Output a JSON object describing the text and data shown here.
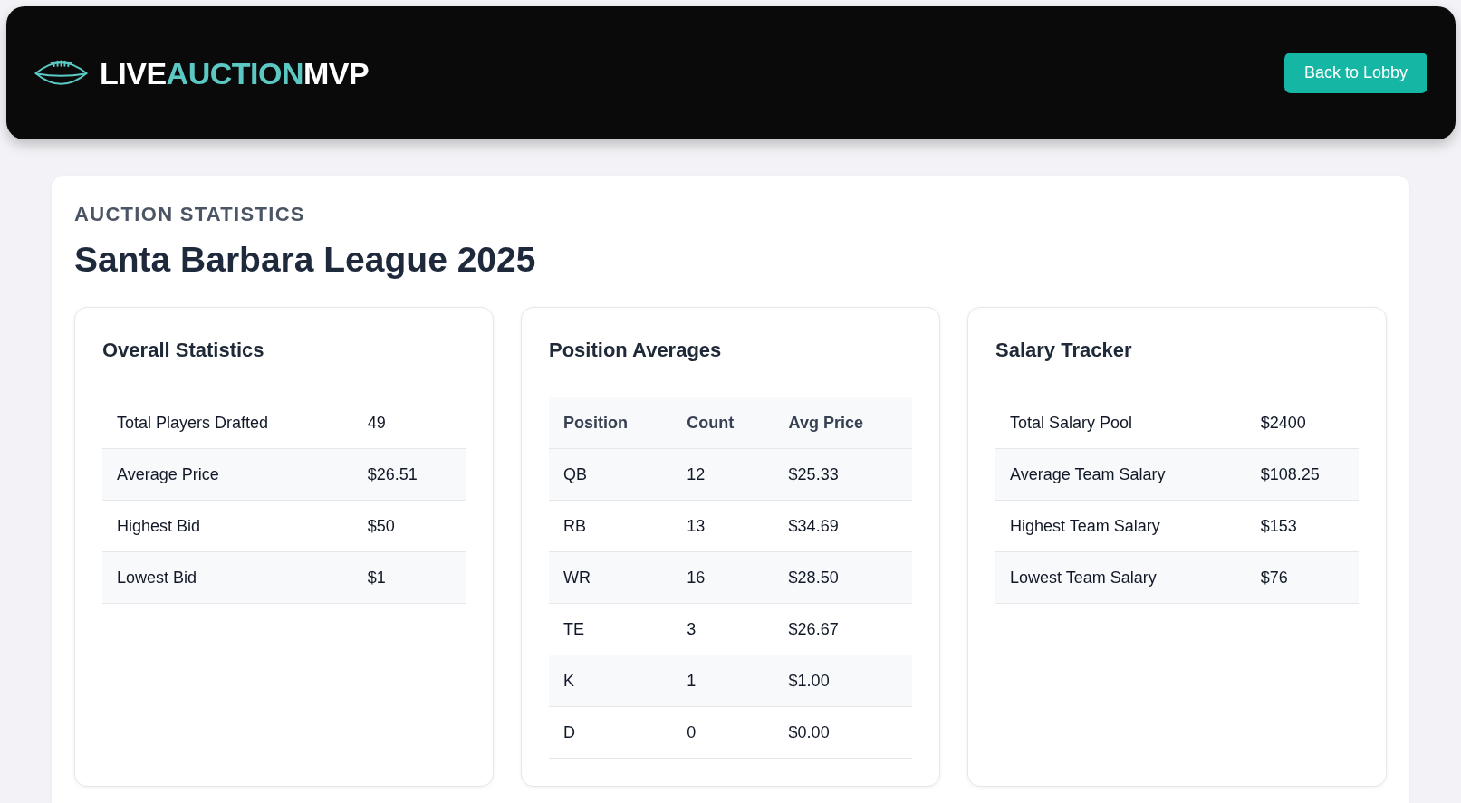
{
  "header": {
    "logo": [
      {
        "text": "LIVE",
        "kind": "plain"
      },
      {
        "text": "AUCTION",
        "kind": "accent"
      },
      {
        "text": "MVP",
        "kind": "plain"
      }
    ],
    "back_button": "Back to Lobby"
  },
  "page": {
    "eyebrow": "AUCTION STATISTICS",
    "title": "Santa Barbara League 2025"
  },
  "panels": [
    {
      "kind": "stats",
      "title": "Overall Statistics",
      "rows": [
        {
          "label": "Total Players Drafted",
          "value": "49"
        },
        {
          "label": "Average Price",
          "value": "$26.51"
        },
        {
          "label": "Highest Bid",
          "value": "$50"
        },
        {
          "label": "Lowest Bid",
          "value": "$1"
        }
      ]
    },
    {
      "kind": "table",
      "title": "Position Averages",
      "columns": [
        "Position",
        "Count",
        "Avg Price"
      ],
      "rows": [
        [
          "QB",
          "12",
          "$25.33"
        ],
        [
          "RB",
          "13",
          "$34.69"
        ],
        [
          "WR",
          "16",
          "$28.50"
        ],
        [
          "TE",
          "3",
          "$26.67"
        ],
        [
          "K",
          "1",
          "$1.00"
        ],
        [
          "D",
          "0",
          "$0.00"
        ]
      ]
    },
    {
      "kind": "stats",
      "title": "Salary Tracker",
      "rows": [
        {
          "label": "Total Salary Pool",
          "value": "$2400"
        },
        {
          "label": "Average Team Salary",
          "value": "$108.25"
        },
        {
          "label": "Highest Team Salary",
          "value": "$153"
        },
        {
          "label": "Lowest Team Salary",
          "value": "$76"
        }
      ]
    }
  ]
}
